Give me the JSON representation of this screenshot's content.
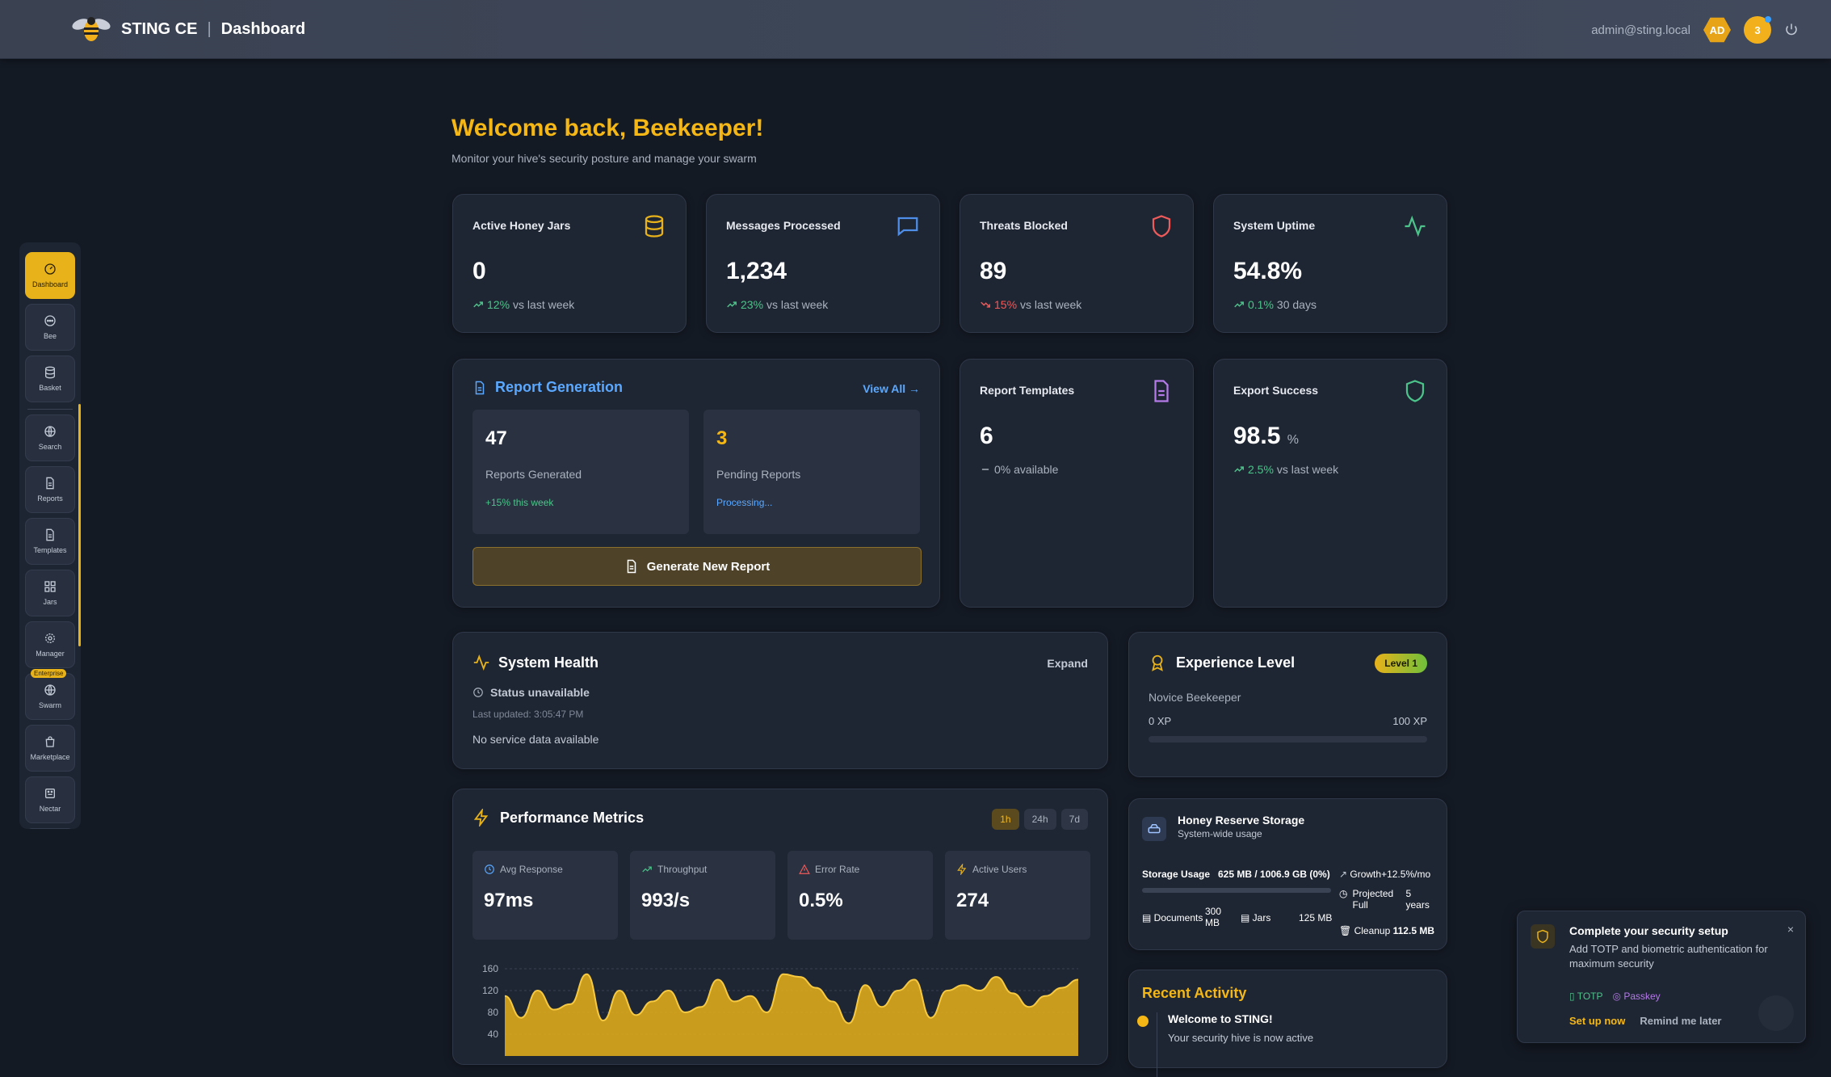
{
  "header": {
    "brand": "STING CE",
    "separator": "|",
    "page": "Dashboard",
    "user_email": "admin@sting.local",
    "avatar_initials": "AD",
    "notifications_count": "3"
  },
  "sidebar": {
    "items": [
      {
        "label": "Dashboard",
        "icon": "gauge-icon"
      },
      {
        "label": "Bee",
        "icon": "chat-icon"
      },
      {
        "label": "Basket",
        "icon": "database-icon"
      },
      {
        "label": "Search",
        "icon": "globe-icon"
      },
      {
        "label": "Reports",
        "icon": "document-icon"
      },
      {
        "label": "Templates",
        "icon": "document-icon"
      },
      {
        "label": "Jars",
        "icon": "grid-icon"
      },
      {
        "label": "Manager",
        "icon": "gear-icon"
      },
      {
        "label": "Swarm",
        "icon": "globe-icon",
        "badge": "Enterprise"
      },
      {
        "label": "Marketplace",
        "icon": "bag-icon"
      },
      {
        "label": "Nectar",
        "icon": "bot-icon"
      }
    ]
  },
  "welcome": {
    "title": "Welcome back, Beekeeper!",
    "subtitle": "Monitor your hive's security posture and manage your swarm"
  },
  "stats": [
    {
      "title": "Active Honey Jars",
      "value": "0",
      "trend": "12%",
      "trend_text": "vs last week",
      "trend_dir": "up",
      "icon": "database-icon",
      "icon_color": "#e8b21a"
    },
    {
      "title": "Messages Processed",
      "value": "1,234",
      "trend": "23%",
      "trend_text": "vs last week",
      "trend_dir": "up",
      "icon": "chat-icon",
      "icon_color": "#4f8ee8"
    },
    {
      "title": "Threats Blocked",
      "value": "89",
      "trend": "15%",
      "trend_text": "vs last week",
      "trend_dir": "down",
      "icon": "shield-icon",
      "icon_color": "#ef5a5a"
    },
    {
      "title": "System Uptime",
      "value": "54.8%",
      "trend": "0.1%",
      "trend_text": "30 days",
      "trend_dir": "up",
      "icon": "activity-icon",
      "icon_color": "#4cc38a"
    }
  ],
  "report_generation": {
    "title": "Report Generation",
    "view_all": "View All →",
    "generated": {
      "value": "47",
      "label": "Reports Generated",
      "note": "+15% this week"
    },
    "pending": {
      "value": "3",
      "label": "Pending Reports",
      "note": "Processing..."
    },
    "button": "Generate New Report"
  },
  "report_templates": {
    "title": "Report Templates",
    "value": "6",
    "trend": "0% available"
  },
  "export_success": {
    "title": "Export Success",
    "value": "98.5",
    "unit": "%",
    "trend": "2.5%",
    "trend_text": "vs last week"
  },
  "system_health": {
    "title": "System Health",
    "expand": "Expand",
    "status": "Status unavailable",
    "updated": "Last updated: 3:05:47 PM",
    "nodata": "No service data available"
  },
  "experience": {
    "title": "Experience Level",
    "badge": "Level 1",
    "rank": "Novice Beekeeper",
    "min": "0 XP",
    "max": "100 XP",
    "progress": 0
  },
  "performance": {
    "title": "Performance Metrics",
    "tabs": [
      "1h",
      "24h",
      "7d"
    ],
    "active_tab": "1h",
    "metrics": [
      {
        "label": "Avg Response",
        "value": "97ms",
        "icon": "clock-icon"
      },
      {
        "label": "Throughput",
        "value": "993/s",
        "icon": "trend-up-icon"
      },
      {
        "label": "Error Rate",
        "value": "0.5%",
        "icon": "warning-icon"
      },
      {
        "label": "Active Users",
        "value": "274",
        "icon": "bolt-icon"
      }
    ]
  },
  "chart_data": {
    "type": "area",
    "title": "",
    "xlabel": "",
    "ylabel": "",
    "yticks": [
      "160",
      "120",
      "80",
      "40"
    ],
    "ylim": [
      0,
      160
    ],
    "grid": true,
    "series": [
      {
        "values": [
          110,
          70,
          120,
          85,
          95,
          150,
          65,
          120,
          75,
          100,
          120,
          80,
          90,
          140,
          100,
          110,
          80,
          150,
          145,
          125,
          100,
          60,
          130,
          90,
          120,
          140,
          70,
          120,
          130,
          120,
          145,
          115,
          90,
          110,
          125,
          140
        ]
      }
    ],
    "color": "#e8b21a"
  },
  "honey_reserve": {
    "title": "Honey Reserve Storage",
    "subtitle": "System-wide usage",
    "usage_label": "Storage Usage",
    "usage_value": "625 MB / 1006.9 GB (0%)",
    "growth": "Growth",
    "growth_value": "+12.5%/mo",
    "projected_label": "Projected Full",
    "projected_value": "5 years",
    "cleanup_label": "Cleanup",
    "cleanup_value": "112.5 MB",
    "documents_label": "Documents",
    "documents_value": "300 MB",
    "jars_label": "Jars",
    "jars_value": "125 MB"
  },
  "recent_activity": {
    "title": "Recent Activity",
    "item": "Welcome to STING!",
    "desc": "Your security hive is now active"
  },
  "toast": {
    "title": "Complete your security setup",
    "body": "Add TOTP and biometric authentication for maximum security",
    "tag1": "TOTP",
    "tag2": "Passkey",
    "action1": "Set up now",
    "action2": "Remind me later",
    "close": "×"
  }
}
